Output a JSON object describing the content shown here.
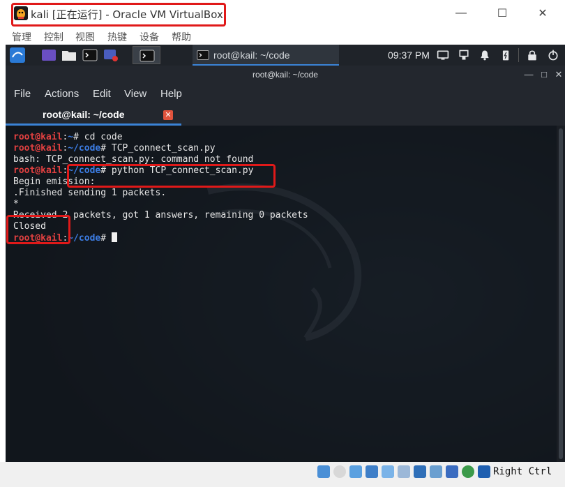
{
  "window": {
    "title": "kali [正在运行] - Oracle VM VirtualBox",
    "menu": [
      "管理",
      "控制",
      "视图",
      "热键",
      "设备",
      "帮助"
    ]
  },
  "guest_panel": {
    "task_label": "root@kail: ~/code",
    "clock": "09:37 PM"
  },
  "terminal": {
    "title": "root@kail: ~/code",
    "menu": [
      "File",
      "Actions",
      "Edit",
      "View",
      "Help"
    ],
    "tab_label": "root@kail: ~/code",
    "lines": [
      {
        "user": "root@kail",
        "sep": ":",
        "path": "~",
        "cmd": "# cd code"
      },
      {
        "user": "root@kail",
        "sep": ":",
        "path": "~/code",
        "cmd": "# TCP_connect_scan.py"
      },
      {
        "text": "bash: TCP_connect_scan.py: command not found"
      },
      {
        "user": "root@kail",
        "sep": ":",
        "path": "~/code",
        "cmd": "# python TCP_connect_scan.py"
      },
      {
        "text": "Begin emission:"
      },
      {
        "text": ".Finished sending 1 packets."
      },
      {
        "text": "*"
      },
      {
        "text": "Received 2 packets, got 1 answers, remaining 0 packets"
      },
      {
        "text": "Closed"
      },
      {
        "user": "root@kail",
        "sep": ":",
        "path": "~/code",
        "cmd": "# ",
        "cursor": true
      }
    ]
  },
  "statusbar": {
    "host_key": "Right Ctrl"
  }
}
